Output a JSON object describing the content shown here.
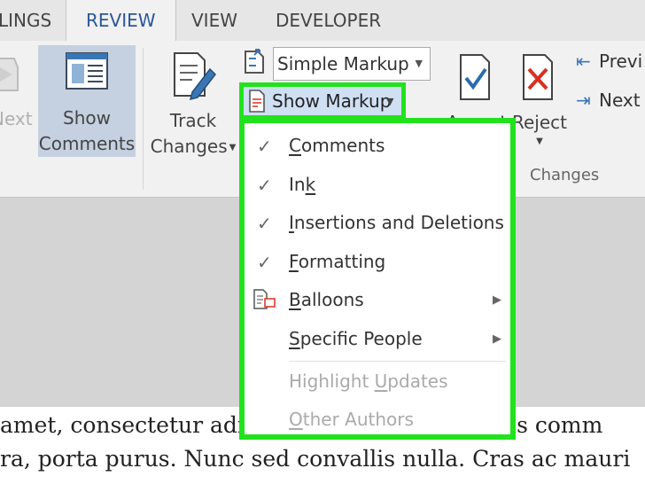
{
  "tabs": [
    {
      "label": "LINGS",
      "active": false
    },
    {
      "label": "REVIEW",
      "active": true
    },
    {
      "label": "VIEW",
      "active": false
    },
    {
      "label": "DEVELOPER",
      "active": false
    }
  ],
  "ribbon": {
    "next_partial": "Next",
    "show_comments": {
      "line1": "Show",
      "line2": "Comments"
    },
    "track_changes": {
      "line1": "Track",
      "line2": "Changes"
    },
    "markup_dropdown": {
      "value": "Simple Markup"
    },
    "show_markup": {
      "label": "Show Markup"
    },
    "accept_partial": "Accept",
    "reject": {
      "label": "Reject"
    },
    "previous_partial": "Previ",
    "next_label": "Next",
    "changes_group": "Changes"
  },
  "menu": {
    "items": [
      {
        "label": "Comments",
        "access_key": "C",
        "checked": true
      },
      {
        "label": "Ink",
        "access_key": "k",
        "checked": true
      },
      {
        "label": "Insertions and Deletions",
        "access_key": "I",
        "checked": true
      },
      {
        "label": "Formatting",
        "access_key": "F",
        "checked": true
      },
      {
        "label": "Balloons",
        "access_key": "B",
        "submenu": true
      },
      {
        "label": "Specific People",
        "access_key": "S",
        "submenu": true
      },
      {
        "label": "Highlight Updates",
        "access_key": "U",
        "disabled": true
      },
      {
        "label": "Other Authors",
        "access_key": "O",
        "disabled": true
      }
    ]
  },
  "document": {
    "line1": "amet, consectetur adipiscing elit. Aenean risus comm",
    "line2": "ra, porta purus. Nunc sed convallis nulla. Cras ac mauri"
  },
  "colors": {
    "highlight": "#22e21d",
    "accent": "#2b579a"
  }
}
